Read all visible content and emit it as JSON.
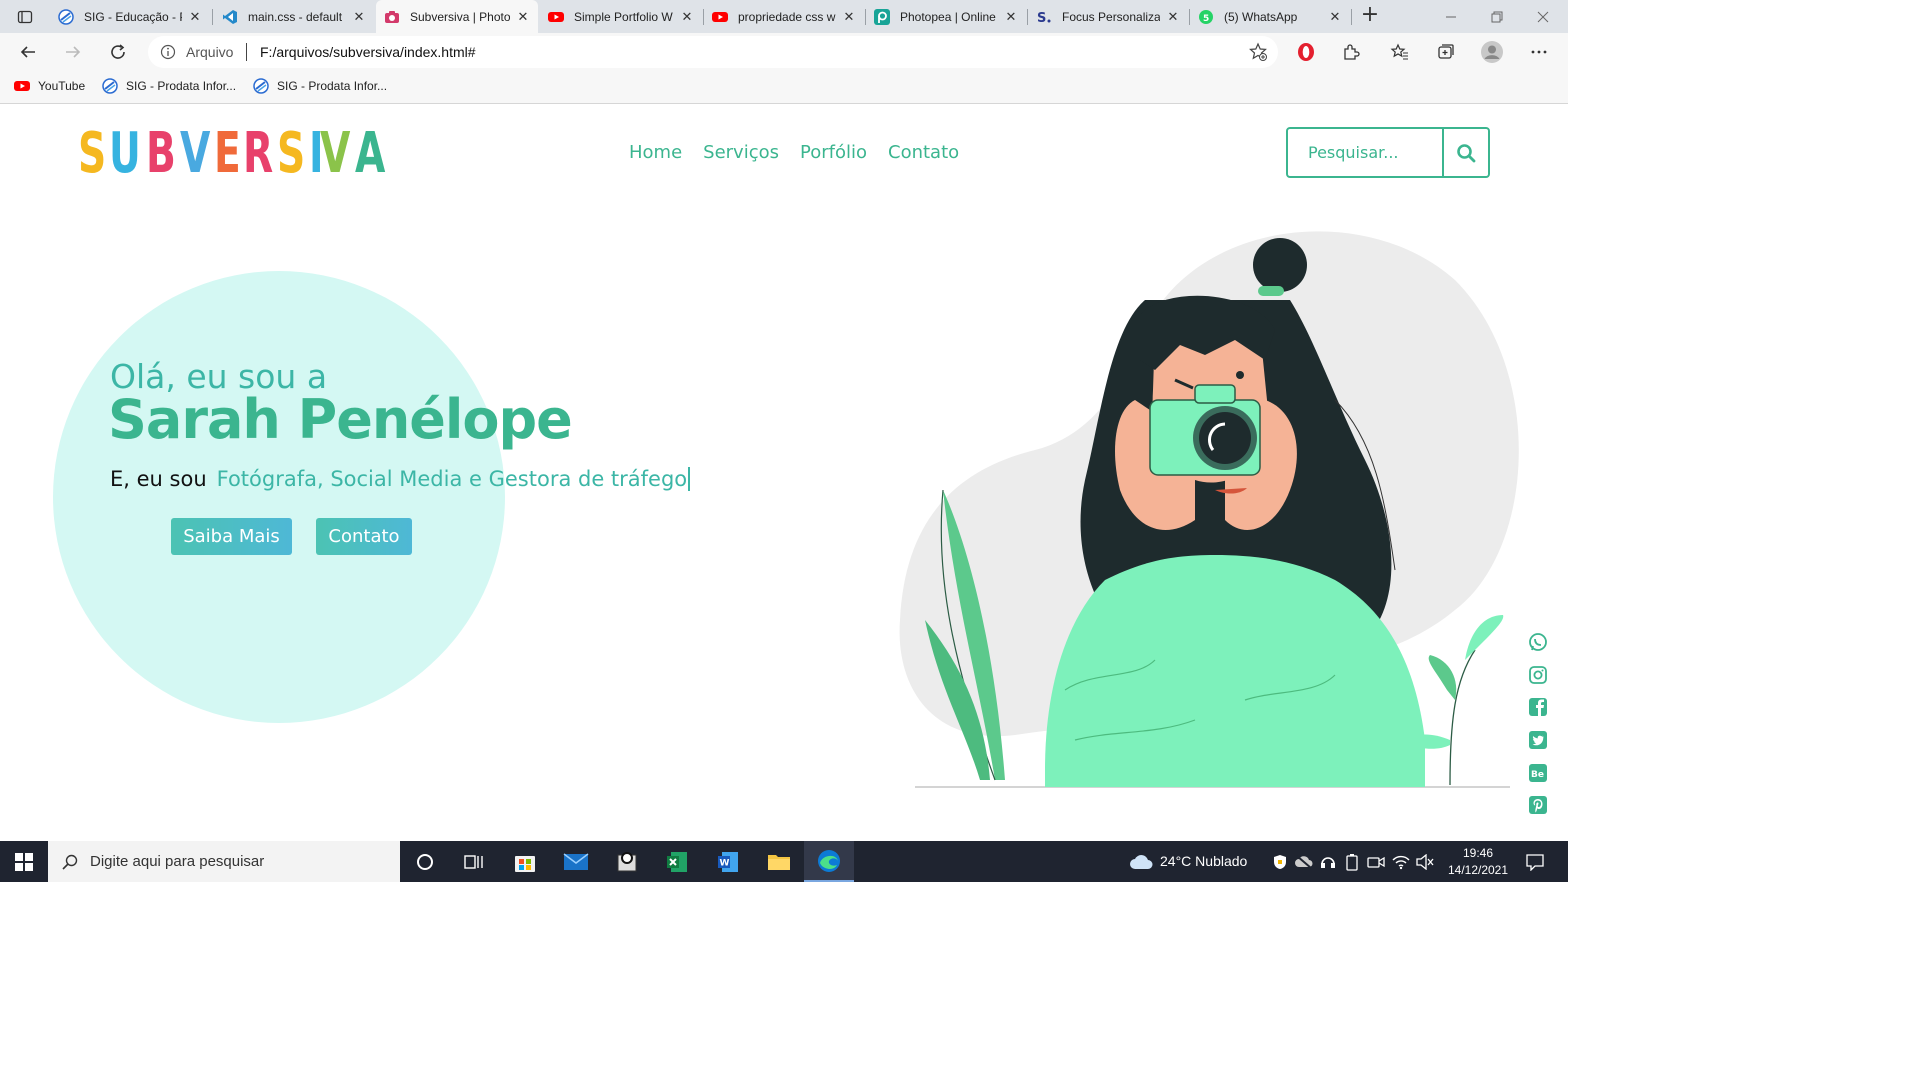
{
  "browser": {
    "tabs": [
      {
        "label": "SIG - Educação - P",
        "icon": "sig-favicon",
        "active": false
      },
      {
        "label": "main.css - default",
        "icon": "vscode-favicon",
        "active": false
      },
      {
        "label": "Subversiva | Photo",
        "icon": "camera-favicon",
        "active": true
      },
      {
        "label": "Simple Portfolio W",
        "icon": "youtube-favicon",
        "active": false
      },
      {
        "label": "propriedade css w",
        "icon": "youtube-favicon",
        "active": false
      },
      {
        "label": "Photopea | Online",
        "icon": "photopea-favicon",
        "active": false
      },
      {
        "label": "Focus Personaliza",
        "icon": "focus-favicon",
        "active": false
      },
      {
        "label": "(5) WhatsApp",
        "icon": "whatsapp-favicon",
        "active": false
      }
    ],
    "address": {
      "label": "Arquivo",
      "url": "F:/arquivos/subversiva/index.html#"
    },
    "bookmarks": [
      {
        "label": "YouTube",
        "icon": "youtube-favicon"
      },
      {
        "label": "SIG - Prodata Infor...",
        "icon": "sig-favicon"
      },
      {
        "label": "SIG - Prodata Infor...",
        "icon": "sig-favicon"
      }
    ]
  },
  "site": {
    "logo": "SUBVERSIVA",
    "logo_colors": [
      "#f5b820",
      "#36b3e0",
      "#e8416b",
      "#49a9e0",
      "#f06a3a",
      "#e8416b",
      "#f5b820",
      "#36b3e0",
      "#8bc34a",
      "#3bb58f"
    ],
    "nav": [
      "Home",
      "Serviços",
      "Porfólio",
      "Contato"
    ],
    "search_placeholder": "Pesquisar...",
    "greeting": "Olá, eu sou a",
    "name": "Sarah Penélope",
    "role_prefix": "E, eu sou",
    "role_typed": "Fotógrafa, Social Media e Gestora de tráfego",
    "buttons": {
      "primary": "Saiba Mais",
      "secondary": "Contato"
    },
    "social": [
      "whatsapp-icon",
      "instagram-icon",
      "facebook-icon",
      "twitter-icon",
      "behance-icon",
      "pinterest-icon"
    ],
    "accent": "#3bb58f"
  },
  "taskbar": {
    "search_placeholder": "Digite aqui para pesquisar",
    "weather": "24°C  Nublado",
    "time": "19:46",
    "date": "14/12/2021"
  }
}
